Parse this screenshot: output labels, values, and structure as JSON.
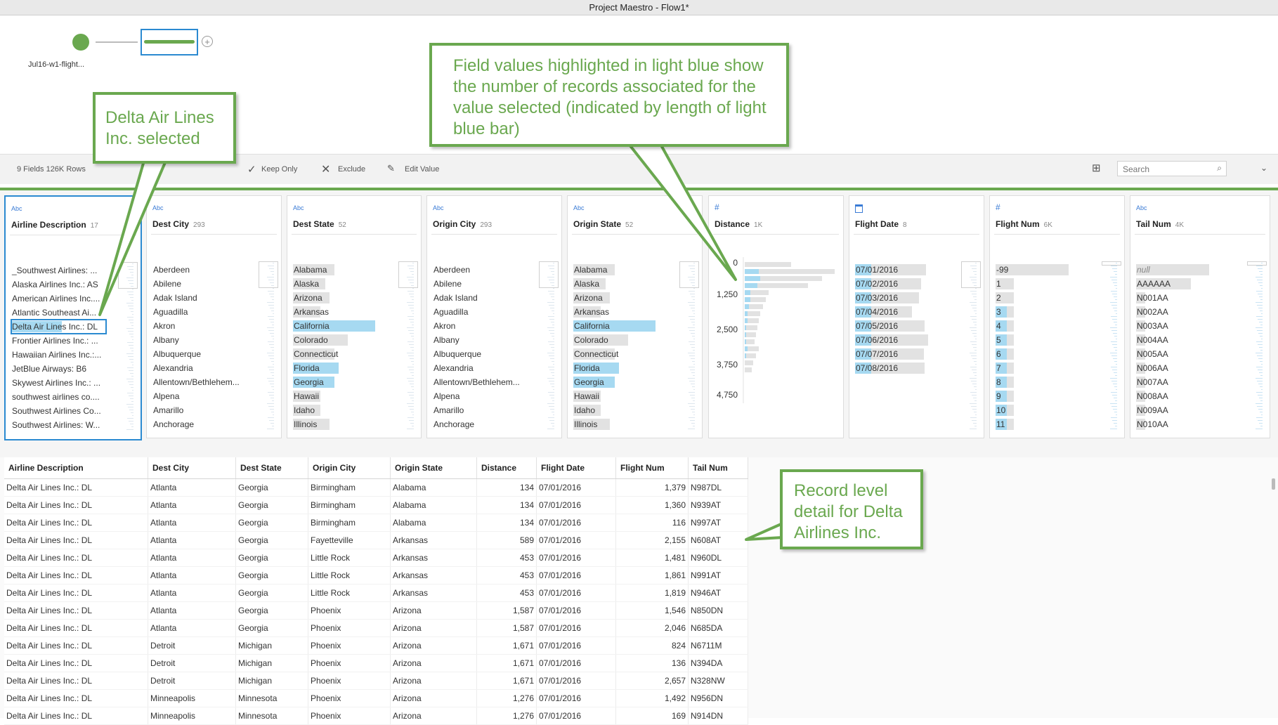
{
  "window": {
    "title": "Project Maestro - Flow1*"
  },
  "flow": {
    "input_label": "Jul16-w1-flight...",
    "add_symbol": "+"
  },
  "toolbar": {
    "fields_rows": "9 Fields  126K Rows",
    "keep_only": "Keep Only",
    "exclude": "Exclude",
    "edit_value": "Edit Value",
    "search_placeholder": "Search"
  },
  "cards": [
    {
      "type": "Abc",
      "name": "Airline Description",
      "count": "17",
      "values": [
        "_Southwest Airlines: ...",
        "Alaska Airlines Inc.: AS",
        "American Airlines Inc....",
        "Atlantic Southeast Ai...",
        "Delta Air Lines Inc.: DL",
        "Frontier Airlines Inc.: ...",
        "Hawaiian Airlines Inc.:...",
        "JetBlue Airways: B6",
        "Skywest Airlines Inc.: ...",
        "southwest airlines co....",
        "Southwest Airlines Co...",
        "Southwest Airlines: W..."
      ]
    },
    {
      "type": "Abc",
      "name": "Dest City",
      "count": "293",
      "values": [
        "Aberdeen",
        "Abilene",
        "Adak Island",
        "Aguadilla",
        "Akron",
        "Albany",
        "Albuquerque",
        "Alexandria",
        "Allentown/Bethlehem...",
        "Alpena",
        "Amarillo",
        "Anchorage"
      ]
    },
    {
      "type": "Abc",
      "name": "Dest State",
      "count": "52",
      "values": [
        "Alabama",
        "Alaska",
        "Arizona",
        "Arkansas",
        "California",
        "Colorado",
        "Connecticut",
        "Florida",
        "Georgia",
        "Hawaii",
        "Idaho",
        "Illinois"
      ]
    },
    {
      "type": "Abc",
      "name": "Origin City",
      "count": "293",
      "values": [
        "Aberdeen",
        "Abilene",
        "Adak Island",
        "Aguadilla",
        "Akron",
        "Albany",
        "Albuquerque",
        "Alexandria",
        "Allentown/Bethlehem...",
        "Alpena",
        "Amarillo",
        "Anchorage"
      ]
    },
    {
      "type": "Abc",
      "name": "Origin State",
      "count": "52",
      "values": [
        "Alabama",
        "Alaska",
        "Arizona",
        "Arkansas",
        "California",
        "Colorado",
        "Connecticut",
        "Florida",
        "Georgia",
        "Hawaii",
        "Idaho",
        "Illinois"
      ]
    },
    {
      "type": "#",
      "name": "Distance",
      "count": "1K",
      "axis": [
        "0",
        "1,250",
        "2,500",
        "3,750",
        "4,750"
      ]
    },
    {
      "type": "date",
      "name": "Flight Date",
      "count": "8",
      "values": [
        "07/01/2016",
        "07/02/2016",
        "07/03/2016",
        "07/04/2016",
        "07/05/2016",
        "07/06/2016",
        "07/07/2016",
        "07/08/2016"
      ]
    },
    {
      "type": "#",
      "name": "Flight Num",
      "count": "6K",
      "values": [
        "-99",
        "1",
        "2",
        "3",
        "4",
        "5",
        "6",
        "7",
        "8",
        "9",
        "10",
        "11"
      ]
    },
    {
      "type": "Abc",
      "name": "Tail Num",
      "count": "4K",
      "values": [
        "null",
        "AAAAAA",
        "N001AA",
        "N002AA",
        "N003AA",
        "N004AA",
        "N005AA",
        "N006AA",
        "N007AA",
        "N008AA",
        "N009AA",
        "N010AA"
      ]
    }
  ],
  "bars": {
    "total": [
      0.05,
      0.15,
      0.3,
      0.2,
      0.5,
      0.4,
      0.3,
      0.25,
      0.3,
      0.1,
      0.4,
      0.3
    ],
    "highlight": [
      0,
      0,
      0,
      0,
      0,
      0,
      0,
      0,
      0,
      0,
      0,
      0
    ]
  },
  "table": {
    "columns": [
      "Airline Description",
      "Dest City",
      "Dest State",
      "Origin City",
      "Origin State",
      "Distance",
      "Flight Date",
      "Flight Num",
      "Tail Num"
    ],
    "rows": [
      [
        "Delta Air Lines Inc.: DL",
        "Atlanta",
        "Georgia",
        "Birmingham",
        "Alabama",
        "134",
        "07/01/2016",
        "1,379",
        "N987DL"
      ],
      [
        "Delta Air Lines Inc.: DL",
        "Atlanta",
        "Georgia",
        "Birmingham",
        "Alabama",
        "134",
        "07/01/2016",
        "1,360",
        "N939AT"
      ],
      [
        "Delta Air Lines Inc.: DL",
        "Atlanta",
        "Georgia",
        "Birmingham",
        "Alabama",
        "134",
        "07/01/2016",
        "116",
        "N997AT"
      ],
      [
        "Delta Air Lines Inc.: DL",
        "Atlanta",
        "Georgia",
        "Fayetteville",
        "Arkansas",
        "589",
        "07/01/2016",
        "2,155",
        "N608AT"
      ],
      [
        "Delta Air Lines Inc.: DL",
        "Atlanta",
        "Georgia",
        "Little Rock",
        "Arkansas",
        "453",
        "07/01/2016",
        "1,481",
        "N960DL"
      ],
      [
        "Delta Air Lines Inc.: DL",
        "Atlanta",
        "Georgia",
        "Little Rock",
        "Arkansas",
        "453",
        "07/01/2016",
        "1,861",
        "N991AT"
      ],
      [
        "Delta Air Lines Inc.: DL",
        "Atlanta",
        "Georgia",
        "Little Rock",
        "Arkansas",
        "453",
        "07/01/2016",
        "1,819",
        "N946AT"
      ],
      [
        "Delta Air Lines Inc.: DL",
        "Atlanta",
        "Georgia",
        "Phoenix",
        "Arizona",
        "1,587",
        "07/01/2016",
        "1,546",
        "N850DN"
      ],
      [
        "Delta Air Lines Inc.: DL",
        "Atlanta",
        "Georgia",
        "Phoenix",
        "Arizona",
        "1,587",
        "07/01/2016",
        "2,046",
        "N685DA"
      ],
      [
        "Delta Air Lines Inc.: DL",
        "Detroit",
        "Michigan",
        "Phoenix",
        "Arizona",
        "1,671",
        "07/01/2016",
        "824",
        "N6711M"
      ],
      [
        "Delta Air Lines Inc.: DL",
        "Detroit",
        "Michigan",
        "Phoenix",
        "Arizona",
        "1,671",
        "07/01/2016",
        "136",
        "N394DA"
      ],
      [
        "Delta Air Lines Inc.: DL",
        "Detroit",
        "Michigan",
        "Phoenix",
        "Arizona",
        "1,671",
        "07/01/2016",
        "2,657",
        "N328NW"
      ],
      [
        "Delta Air Lines Inc.: DL",
        "Minneapolis",
        "Minnesota",
        "Phoenix",
        "Arizona",
        "1,276",
        "07/01/2016",
        "1,492",
        "N956DN"
      ],
      [
        "Delta Air Lines Inc.: DL",
        "Minneapolis",
        "Minnesota",
        "Phoenix",
        "Arizona",
        "1,276",
        "07/01/2016",
        "169",
        "N914DN"
      ]
    ]
  },
  "callouts": {
    "delta_selected": "Delta Air Lines Inc. selected",
    "field_values": "Field values highlighted in light blue show the number of records associated for the value selected (indicated by length of light blue bar)",
    "record_level": "Record level detail for Delta Airlines Inc."
  },
  "colors": {
    "accent_green": "#6aa84f",
    "selection_blue": "#2b8ad1",
    "highlight_blue": "#a6d9f1",
    "bar_gray": "#e2e2e2"
  }
}
